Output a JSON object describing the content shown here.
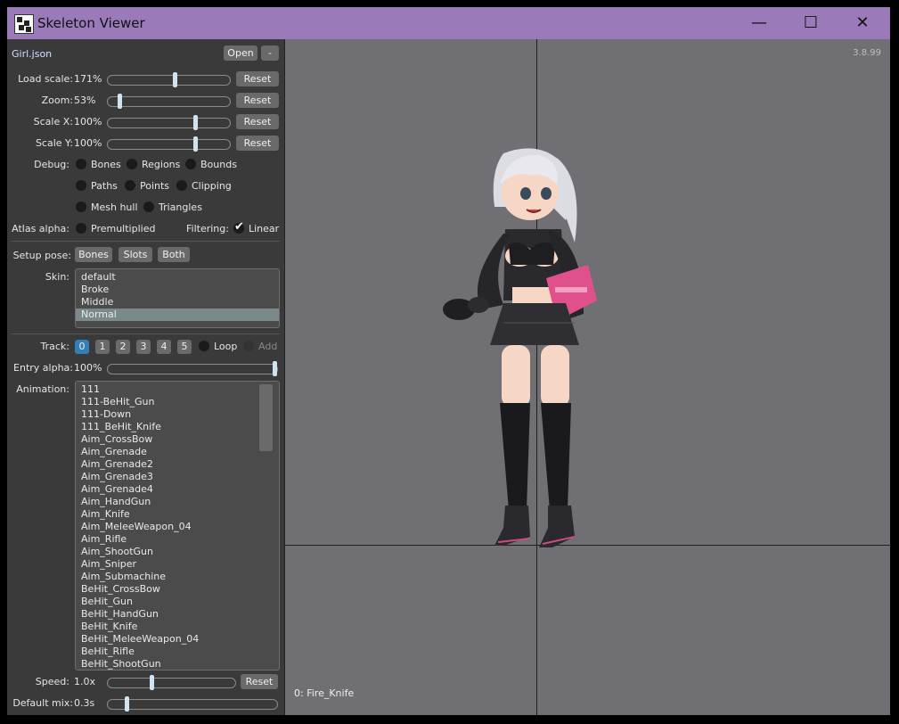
{
  "window": {
    "title": "Skeleton Viewer",
    "minimize_glyph": "—",
    "maximize_glyph": "☐",
    "close_glyph": "✕"
  },
  "file": {
    "name": "Girl.json",
    "open_label": "Open",
    "collapse_label": "-"
  },
  "sliders": {
    "load_scale": {
      "label": "Load scale:",
      "value": "171%",
      "reset": "Reset",
      "level": 0.55
    },
    "zoom": {
      "label": "Zoom:",
      "value": "53%",
      "reset": "Reset",
      "level": 0.08
    },
    "scale_x": {
      "label": "Scale X:",
      "value": "100%",
      "reset": "Reset",
      "level": 0.73
    },
    "scale_y": {
      "label": "Scale Y:",
      "value": "100%",
      "reset": "Reset",
      "level": 0.73
    }
  },
  "debug": {
    "label": "Debug:",
    "options": [
      "Bones",
      "Regions",
      "Bounds",
      "Paths",
      "Points",
      "Clipping",
      "Mesh hull",
      "Triangles"
    ]
  },
  "atlas": {
    "label": "Atlas alpha:",
    "premultiplied": "Premultiplied",
    "filtering_label": "Filtering:",
    "linear": "Linear"
  },
  "setup_pose": {
    "label": "Setup pose:",
    "bones": "Bones",
    "slots": "Slots",
    "both": "Both"
  },
  "skin": {
    "label": "Skin:",
    "items": [
      "default",
      "Broke",
      "Middle",
      "Normal"
    ],
    "selected": "Normal"
  },
  "track": {
    "label": "Track:",
    "numbers": [
      "0",
      "1",
      "2",
      "3",
      "4",
      "5"
    ],
    "active": "0",
    "loop": "Loop",
    "add": "Add"
  },
  "entry_alpha": {
    "label": "Entry alpha:",
    "value": "100%",
    "level": 1.0
  },
  "animation": {
    "label": "Animation:",
    "items": [
      "111",
      "111-BeHit_Gun",
      "111-Down",
      "111_BeHit_Knife",
      "Aim_CrossBow",
      "Aim_Grenade",
      "Aim_Grenade2",
      "Aim_Grenade3",
      "Aim_Grenade4",
      "Aim_HandGun",
      "Aim_Knife",
      "Aim_MeleeWeapon_04",
      "Aim_Rifle",
      "Aim_ShootGun",
      "Aim_Sniper",
      "Aim_Submachine",
      "BeHit_CrossBow",
      "BeHit_Gun",
      "BeHit_HandGun",
      "BeHit_Knife",
      "BeHit_MeleeWeapon_04",
      "BeHit_Rifle",
      "BeHit_ShootGun"
    ]
  },
  "speed": {
    "label": "Speed:",
    "value": "1.0x",
    "reset": "Reset",
    "level": 0.34
  },
  "default_mix": {
    "label": "Default mix:",
    "value": "0.3s",
    "level": 0.1
  },
  "viewport": {
    "version": "3.8.99",
    "status": "0: Fire_Knife"
  },
  "colors": {
    "titlebar": "#9a7ab8",
    "panel": "#3a3a3a",
    "viewport": "#6f6f74",
    "accent": "#2f7fb8"
  }
}
